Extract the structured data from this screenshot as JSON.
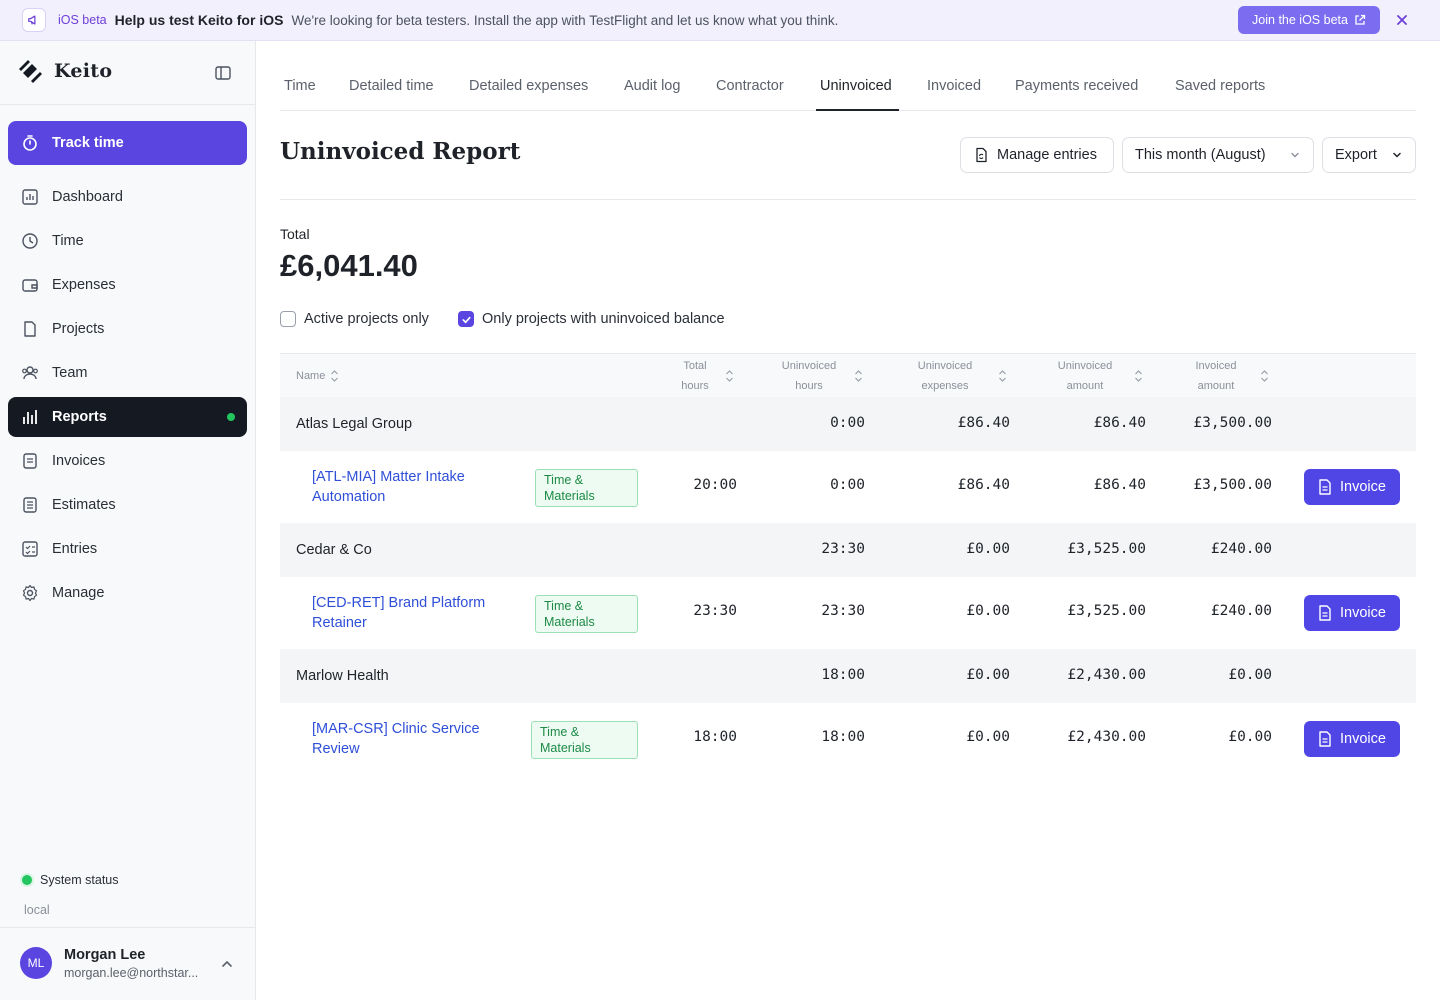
{
  "banner": {
    "tag": "iOS beta",
    "title": "Help us test Keito for iOS",
    "text": "We're looking for beta testers. Install the app with TestFlight and let us know what you think.",
    "button": "Join the iOS beta"
  },
  "sidebar": {
    "brand": "Keito",
    "items": [
      {
        "label": "Track time",
        "icon": "stopwatch-icon"
      },
      {
        "label": "Dashboard",
        "icon": "chart-icon"
      },
      {
        "label": "Time",
        "icon": "clock-icon"
      },
      {
        "label": "Expenses",
        "icon": "wallet-icon"
      },
      {
        "label": "Projects",
        "icon": "folder-icon"
      },
      {
        "label": "Team",
        "icon": "users-icon"
      },
      {
        "label": "Reports",
        "icon": "bar-chart-icon"
      },
      {
        "label": "Invoices",
        "icon": "document-icon"
      },
      {
        "label": "Estimates",
        "icon": "list-document-icon"
      },
      {
        "label": "Entries",
        "icon": "checklist-icon"
      },
      {
        "label": "Manage",
        "icon": "gear-icon"
      }
    ],
    "system_status": "System status",
    "environment": "local",
    "user": {
      "initials": "ML",
      "name": "Morgan Lee",
      "email": "morgan.lee@northstar..."
    }
  },
  "tabs": [
    "Time",
    "Detailed time",
    "Detailed expenses",
    "Audit log",
    "Contractor",
    "Uninvoiced",
    "Invoiced",
    "Payments received",
    "Saved reports"
  ],
  "active_tab": "Uninvoiced",
  "header": {
    "title": "Uninvoiced Report",
    "manage_entries": "Manage entries",
    "period": "This month (August)",
    "export": "Export"
  },
  "summary": {
    "total_label": "Total",
    "total_value": "£6,041.40"
  },
  "filters": {
    "active_only": {
      "label": "Active projects only",
      "checked": false
    },
    "uninvoiced_balance": {
      "label": "Only projects with uninvoiced balance",
      "checked": true
    }
  },
  "table": {
    "columns": {
      "name": "Name",
      "total_hours": [
        "Total",
        "hours"
      ],
      "uninvoiced_hours": [
        "Uninvoiced",
        "hours"
      ],
      "uninvoiced_expenses": [
        "Uninvoiced",
        "expenses"
      ],
      "uninvoiced_amount": [
        "Uninvoiced",
        "amount"
      ],
      "invoiced_amount": [
        "Invoiced",
        "amount"
      ]
    },
    "invoice_button": "Invoice",
    "groups": [
      {
        "client": "Atlas Legal Group",
        "uninvoiced_hours": "0:00",
        "uninvoiced_expenses": "£86.40",
        "uninvoiced_amount": "£86.40",
        "invoiced_amount": "£3,500.00",
        "project": {
          "name_line1": "[ATL-MIA] Matter Intake",
          "name_line2": "Automation",
          "billing_line1": "Time &",
          "billing_line2": "Materials",
          "total_hours": "20:00",
          "uninvoiced_hours": "0:00",
          "uninvoiced_expenses": "£86.40",
          "uninvoiced_amount": "£86.40",
          "invoiced_amount": "£3,500.00"
        }
      },
      {
        "client": "Cedar & Co",
        "uninvoiced_hours": "23:30",
        "uninvoiced_expenses": "£0.00",
        "uninvoiced_amount": "£3,525.00",
        "invoiced_amount": "£240.00",
        "project": {
          "name_line1": "[CED-RET] Brand Platform",
          "name_line2": "Retainer",
          "billing_line1": "Time &",
          "billing_line2": "Materials",
          "total_hours": "23:30",
          "uninvoiced_hours": "23:30",
          "uninvoiced_expenses": "£0.00",
          "uninvoiced_amount": "£3,525.00",
          "invoiced_amount": "£240.00"
        }
      },
      {
        "client": "Marlow Health",
        "uninvoiced_hours": "18:00",
        "uninvoiced_expenses": "£0.00",
        "uninvoiced_amount": "£2,430.00",
        "invoiced_amount": "£0.00",
        "project": {
          "name_line1": "[MAR-CSR] Clinic Service",
          "name_line2": "Review",
          "billing_line1": "Time &",
          "billing_line2": "Materials",
          "total_hours": "18:00",
          "uninvoiced_hours": "18:00",
          "uninvoiced_expenses": "£0.00",
          "uninvoiced_amount": "£2,430.00",
          "invoiced_amount": "£0.00"
        }
      }
    ]
  },
  "colors": {
    "accent": "#5b45e0",
    "active_nav": "#151a22",
    "status_green": "#22c55e",
    "link": "#2f4fd8"
  }
}
